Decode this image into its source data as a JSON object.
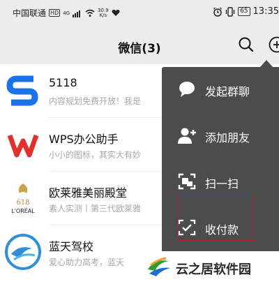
{
  "status_bar": {
    "carrier": "中国联通",
    "hd": "HD",
    "signal": "4G",
    "speed": "30.9",
    "speed_unit": "K/s",
    "battery": "65",
    "time": "13:35"
  },
  "header": {
    "title": "微信(3)",
    "search_icon": "search-icon",
    "add_icon": "add-circle-icon"
  },
  "chats": [
    {
      "name": "5118",
      "preview": "内容规划免费开放！我是"
    },
    {
      "name": "WPS办公助手",
      "preview": "小小的图标，其实大有妙"
    },
    {
      "name": "欧莱雅美丽殿堂",
      "preview": "素人实测丨第三代欧莱雅"
    },
    {
      "name": "蓝天驾校",
      "preview": "爱心助力高考，蓝天"
    }
  ],
  "avatars": {
    "wps_logo_text": "W",
    "loreal_logo_text": "L'ORÉAL",
    "loreal_sub": "618"
  },
  "menu": {
    "items": [
      {
        "label": "发起群聊",
        "icon": "chat-bubble-icon"
      },
      {
        "label": "添加朋友",
        "icon": "add-friend-icon"
      },
      {
        "label": "扫一扫",
        "icon": "scan-icon"
      },
      {
        "label": "收付款",
        "icon": "payment-scan-icon"
      }
    ]
  },
  "watermark": {
    "text": "云之居软件园"
  },
  "colors": {
    "header_bg": "#ededed",
    "menu_bg": "#4c4c4c",
    "highlight": "#b22222",
    "blue_logo": "#1a73e8"
  }
}
